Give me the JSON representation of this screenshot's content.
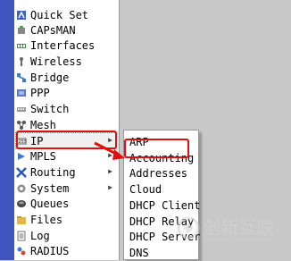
{
  "main_menu": {
    "items": [
      {
        "label": "Quick Set",
        "icon": "quick-set-icon"
      },
      {
        "label": "CAPsMAN",
        "icon": "capsman-icon"
      },
      {
        "label": "Interfaces",
        "icon": "interfaces-icon"
      },
      {
        "label": "Wireless",
        "icon": "wireless-icon"
      },
      {
        "label": "Bridge",
        "icon": "bridge-icon"
      },
      {
        "label": "PPP",
        "icon": "ppp-icon"
      },
      {
        "label": "Switch",
        "icon": "switch-icon"
      },
      {
        "label": "Mesh",
        "icon": "mesh-icon"
      },
      {
        "label": "IP",
        "icon": "ip-icon",
        "submenu_arrow": "▶"
      },
      {
        "label": "MPLS",
        "icon": "mpls-icon",
        "submenu_arrow": "▶"
      },
      {
        "label": "Routing",
        "icon": "routing-icon",
        "submenu_arrow": "▶"
      },
      {
        "label": "System",
        "icon": "system-icon",
        "submenu_arrow": "▶"
      },
      {
        "label": "Queues",
        "icon": "queues-icon"
      },
      {
        "label": "Files",
        "icon": "files-icon"
      },
      {
        "label": "Log",
        "icon": "log-icon"
      },
      {
        "label": "RADIUS",
        "icon": "radius-icon"
      }
    ]
  },
  "ip_submenu": {
    "items": [
      "ARP",
      "Accounting",
      "Addresses",
      "Cloud",
      "DHCP Client",
      "DHCP Relay",
      "DHCP Server",
      "DNS"
    ]
  },
  "watermark": {
    "chinese": "创新互联",
    "english": "CHUANG XIN HU LIAN"
  },
  "colors": {
    "sidebar_blue": "#4054c0",
    "highlight_red": "#e01010"
  }
}
